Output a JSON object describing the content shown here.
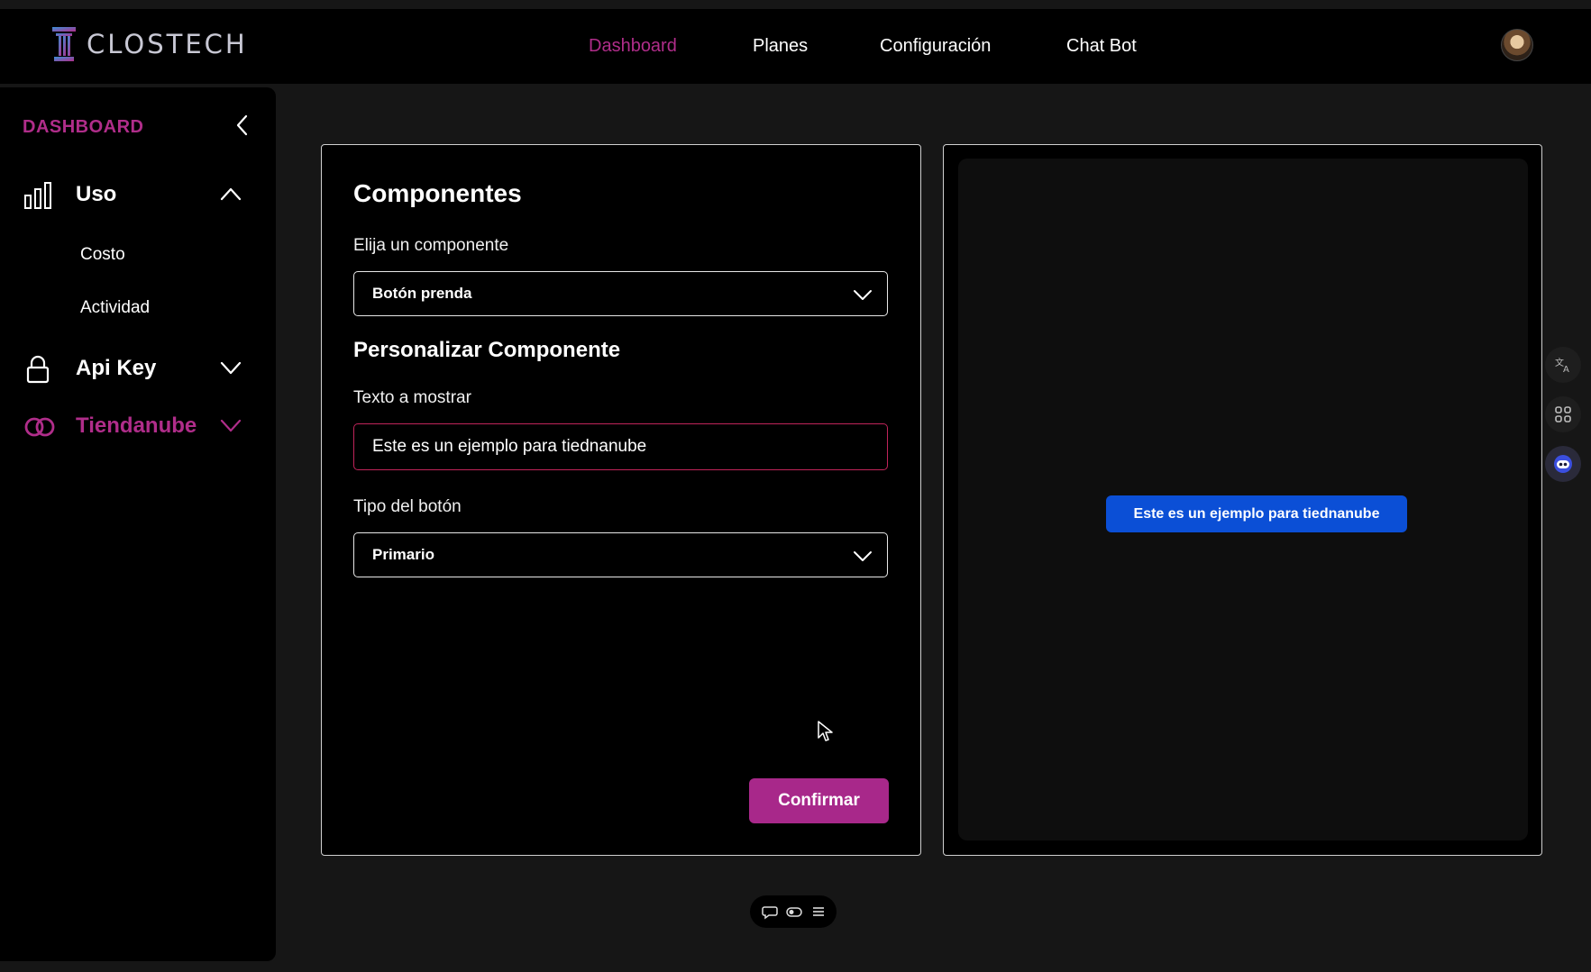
{
  "brand": {
    "name": "CLOSTECH"
  },
  "nav": {
    "items": [
      {
        "label": "Dashboard",
        "active": true
      },
      {
        "label": "Planes",
        "active": false
      },
      {
        "label": "Configuración",
        "active": false
      },
      {
        "label": "Chat Bot",
        "active": false
      }
    ]
  },
  "sidebar": {
    "title": "DASHBOARD",
    "uso": {
      "label": "Uso",
      "sub": [
        "Costo",
        "Actividad"
      ]
    },
    "apikey": {
      "label": "Api Key"
    },
    "tiendanube": {
      "label": "Tiendanube"
    }
  },
  "form": {
    "title": "Componentes",
    "component_label": "Elija un componente",
    "component_value": "Botón prenda",
    "customize_title": "Personalizar Componente",
    "text_label": "Texto a mostrar",
    "text_value": "Este es un ejemplo para tiednanube",
    "button_type_label": "Tipo del botón",
    "button_type_value": "Primario",
    "confirm_label": "Confirmar"
  },
  "preview": {
    "button_label": "Este es un ejemplo para tiednanube"
  },
  "colors": {
    "accent": "#b02d8a",
    "preview_button": "#0b4fd6",
    "background": "#161616"
  },
  "icons": {
    "logo": "column-logo-icon",
    "uso": "bar-chart-icon",
    "apikey": "lock-icon",
    "tiendanube": "tiendanube-cloud-icon",
    "tools": [
      "translate-icon",
      "grid-icon",
      "bot-icon"
    ],
    "bottom": [
      "chat-bubble-icon",
      "toggle-icon",
      "menu-icon"
    ]
  }
}
